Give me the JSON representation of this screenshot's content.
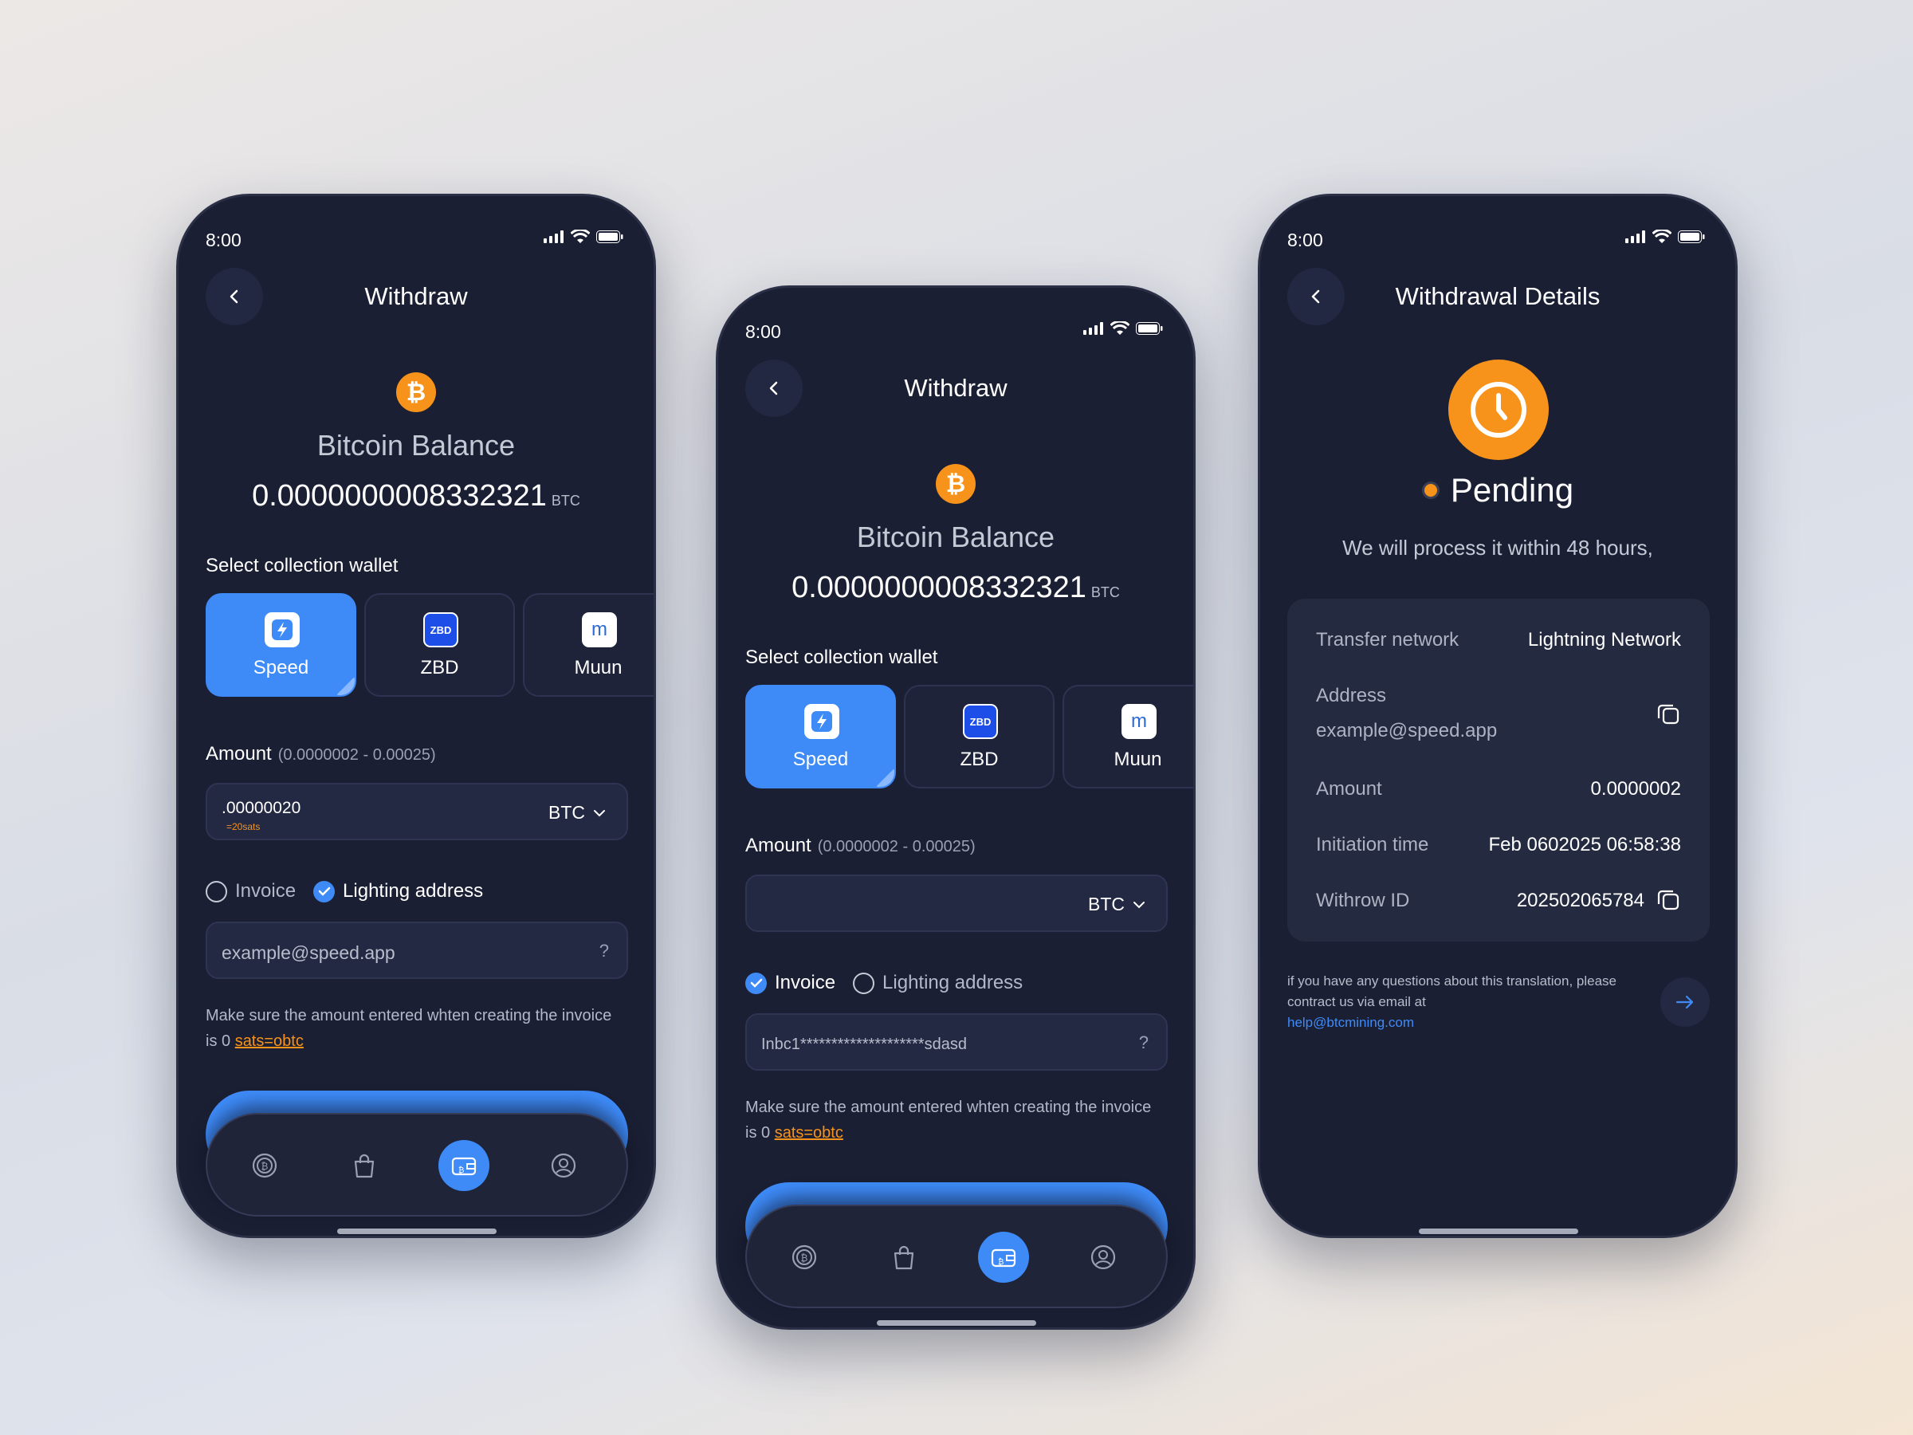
{
  "colors": {
    "accent": "#3e8bf8",
    "bitcoin": "#f7931a",
    "phone_bg": "#1b1f33",
    "card_bg": "#242a40"
  },
  "withdraw_screen_1": {
    "status_time": "8:00",
    "title": "Withdraw",
    "balance_label": "Bitcoin Balance",
    "balance_value": "0.0000000008332321",
    "balance_unit": "BTC",
    "wallet_section_label": "Select collection wallet",
    "wallets": [
      {
        "label": "Speed",
        "icon": "speed-icon",
        "selected": true
      },
      {
        "label": "ZBD",
        "icon": "zbd-icon",
        "icon_text": "ZBD",
        "selected": false
      },
      {
        "label": "Muun",
        "icon": "muun-icon",
        "icon_text": "m",
        "selected": false
      }
    ],
    "amount_label": "Amount",
    "amount_range": "(0.0000002 - 0.00025)",
    "amount_value": ".00000020",
    "amount_sats": "=20sats",
    "currency": "BTC",
    "payment_options": [
      {
        "label": "Invoice",
        "checked": false
      },
      {
        "label": "Lighting address",
        "checked": true
      }
    ],
    "address_placeholder": "example@speed.app",
    "help_mark": "?",
    "note_text": "Make sure the amount entered whten creating the invoice is 0 ",
    "note_link": "sats=obtc"
  },
  "withdraw_screen_2": {
    "status_time": "8:00",
    "title": "Withdraw",
    "balance_label": "Bitcoin Balance",
    "balance_value": "0.0000000008332321",
    "balance_unit": "BTC",
    "wallet_section_label": "Select collection wallet",
    "wallets": [
      {
        "label": "Speed",
        "icon": "speed-icon",
        "selected": true
      },
      {
        "label": "ZBD",
        "icon": "zbd-icon",
        "icon_text": "ZBD",
        "selected": false
      },
      {
        "label": "Muun",
        "icon": "muun-icon",
        "icon_text": "m",
        "selected": false
      }
    ],
    "amount_label": "Amount",
    "amount_range": "(0.0000002 - 0.00025)",
    "currency": "BTC",
    "payment_options": [
      {
        "label": "Invoice",
        "checked": true
      },
      {
        "label": "Lighting address",
        "checked": false
      }
    ],
    "invoice_value": "Inbc1********************sdasd",
    "help_mark": "?",
    "note_text": "Make sure the amount entered whten creating the invoice is 0 ",
    "note_link": "sats=obtc"
  },
  "details_screen": {
    "status_time": "8:00",
    "title": "Withdrawal Details",
    "status": "Pending",
    "status_desc": "We will process it within 48 hours,",
    "rows": {
      "network_label": "Transfer network",
      "network_value": "Lightning Network",
      "address_label": "Address",
      "address_value": "example@speed.app",
      "amount_label": "Amount",
      "amount_value": "0.0000002",
      "time_label": "Initiation time",
      "time_value": "Feb 0602025 06:58:38",
      "id_label": "Withrow ID",
      "id_value": "202502065784"
    },
    "footnote": "if you have any questions about this translation, please contract us via email at",
    "email": "help@btcmining.com"
  },
  "nav_items": [
    "bitcoin-coin-icon",
    "shopping-bag-icon",
    "wallet-icon",
    "profile-icon"
  ]
}
